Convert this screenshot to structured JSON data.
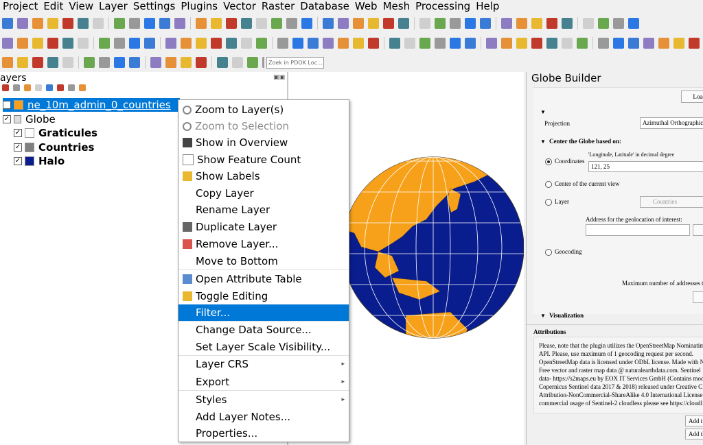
{
  "menubar": [
    "Project",
    "Edit",
    "View",
    "Layer",
    "Settings",
    "Plugins",
    "Vector",
    "Raster",
    "Database",
    "Web",
    "Mesh",
    "Processing",
    "Help"
  ],
  "toolbar": {
    "search_placeholder": "Zoek in PDOK Loc…"
  },
  "layers_panel": {
    "title": "ayers",
    "items": [
      {
        "label": "ne_10m_admin_0_countries",
        "color": "#f7a11a",
        "selected": true
      },
      {
        "label": "Globe",
        "group": true
      },
      {
        "label": "Graticules",
        "color": "#ffffff"
      },
      {
        "label": "Countries",
        "color": "#808080"
      },
      {
        "label": "Halo",
        "color": "#0a1d8f"
      }
    ]
  },
  "context_menu": {
    "items": [
      {
        "label": "Zoom to Layer(s)",
        "icon": "zoom-icon"
      },
      {
        "label": "Zoom to Selection",
        "icon": "zoom-icon",
        "disabled": true
      },
      {
        "label": "Show in Overview",
        "icon": "overview-icon"
      },
      {
        "label": "Show Feature Count",
        "icon": "checkbox-icon"
      },
      {
        "label": "Show Labels",
        "icon": "labels-icon"
      },
      {
        "label": "Copy Layer"
      },
      {
        "label": "Rename Layer"
      },
      {
        "label": "Duplicate Layer",
        "icon": "duplicate-icon"
      },
      {
        "label": "Remove Layer...",
        "icon": "remove-icon"
      },
      {
        "label": "Move to Bottom"
      },
      {
        "label": "Open Attribute Table",
        "icon": "table-icon"
      },
      {
        "label": "Toggle Editing",
        "icon": "pencil-icon"
      },
      {
        "label": "Filter...",
        "highlighted": true
      },
      {
        "label": "Change Data Source..."
      },
      {
        "label": "Set Layer Scale Visibility..."
      },
      {
        "label": "Layer CRS",
        "submenu": true
      },
      {
        "label": "Export",
        "submenu": true
      },
      {
        "label": "Styles",
        "submenu": true
      },
      {
        "label": "Add Layer Notes..."
      },
      {
        "label": "Properties..."
      }
    ]
  },
  "globe_builder": {
    "title": "Globe Builder",
    "load_button": "Load D",
    "projection_label": "Projection",
    "projection_value": "Azimuthal Orthographic",
    "center_section": "Center the Globe based on:",
    "coordinates_label": "Coordinates",
    "coordinates_hint": "'Longitude, Latitude' in decimal degree",
    "coordinates_value": "121, 25",
    "center_view_label": "Center of the current view",
    "layer_label": "Layer",
    "layer_value": "Countries",
    "address_label": "Address for the geolocation of interest:",
    "geocoding_label": "Geocoding",
    "max_addresses_label": "Maximum number of addresses to l",
    "visualization_section": "Visualization",
    "attributions_title": "Attributions",
    "attributions_lines": [
      "Please, note that the plugin utilizes the OpenStreetMap Nominatim",
      "API. Please, use maximum of 1 geocoding request per second.",
      "OpenStreetMap data is licensed under ODbL license. Made with N",
      "Free vector and raster map data @ naturalearthdata.com. Sentinel",
      "data- https://s2maps.eu by EOX IT Services GmbH (Contains mod",
      "Copernicus Sentinel data 2017 & 2018) released under Creative C",
      "Attribution-NonCommercial-ShareAlike 4.0 International License",
      "commercial usage of Sentinel-2 cloudless please see https://cloudl"
    ],
    "add_button_1": "Add t",
    "add_button_2": "Add th"
  },
  "colors": {
    "ocean": "#0a1d8f",
    "land": "#f7a11a",
    "highlight": "#0078d7"
  }
}
